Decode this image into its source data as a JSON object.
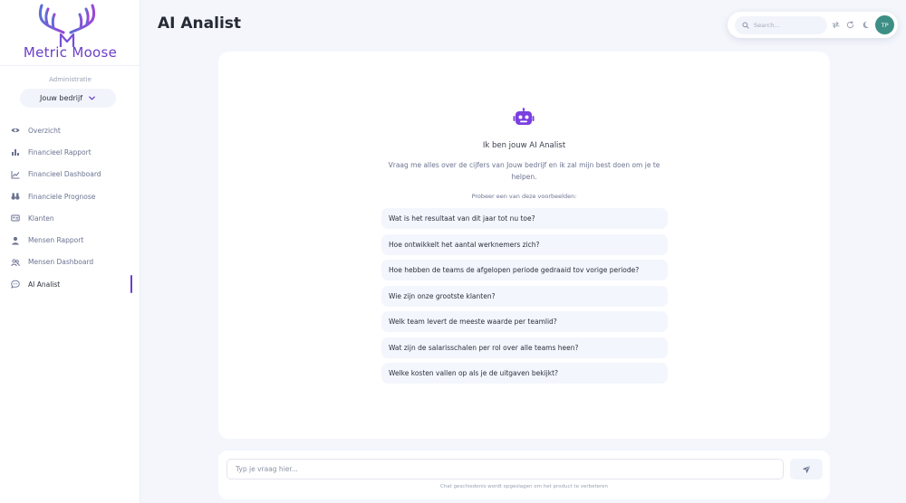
{
  "brand": {
    "name": "Metric Moose",
    "accent_color": "#6c3fc7"
  },
  "sidebar": {
    "admin_label": "Administratie",
    "company_select": {
      "value": "Jouw bedrijf",
      "icon": "chevron-down-icon"
    },
    "items": [
      {
        "label": "Overzicht",
        "icon": "eye-icon"
      },
      {
        "label": "Financieel Rapport",
        "icon": "bar-chart-icon"
      },
      {
        "label": "Financieel Dashboard",
        "icon": "line-chart-icon"
      },
      {
        "label": "Financiele Prognose",
        "icon": "binoculars-icon"
      },
      {
        "label": "Klanten",
        "icon": "address-card-icon"
      },
      {
        "label": "Mensen Rapport",
        "icon": "user-icon"
      },
      {
        "label": "Mensen Dashboard",
        "icon": "users-icon"
      },
      {
        "label": "AI Analist",
        "icon": "chat-icon",
        "active": true
      }
    ]
  },
  "header": {
    "title": "AI Analist",
    "search_placeholder": "Search...",
    "avatar_initials": "TP",
    "avatar_color": "#3d8f85"
  },
  "main": {
    "intro_title": "Ik ben jouw AI Analist",
    "intro_description": "Vraag me alles over de cijfers van Jouw bedrijf en ik zal mijn best doen om je te helpen.",
    "examples_label": "Probeer een van deze voorbeelden:",
    "examples": [
      "Wat is het resultaat van dit jaar tot nu toe?",
      "Hoe ontwikkelt het aantal werknemers zich?",
      "Hoe hebben de teams de afgelopen periode gedraaid tov vorige periode?",
      "Wie zijn onze grootste klanten?",
      "Welk team levert de meeste waarde per teamlid?",
      "Wat zijn de salarisschalen per rol over alle teams heen?",
      "Welke kosten vallen op als je de uitgaven bekijkt?"
    ]
  },
  "chat": {
    "input_placeholder": "Typ je vraag hier...",
    "note": "Chat geschiedenis wordt opgeslagen om het product te verbeteren"
  }
}
